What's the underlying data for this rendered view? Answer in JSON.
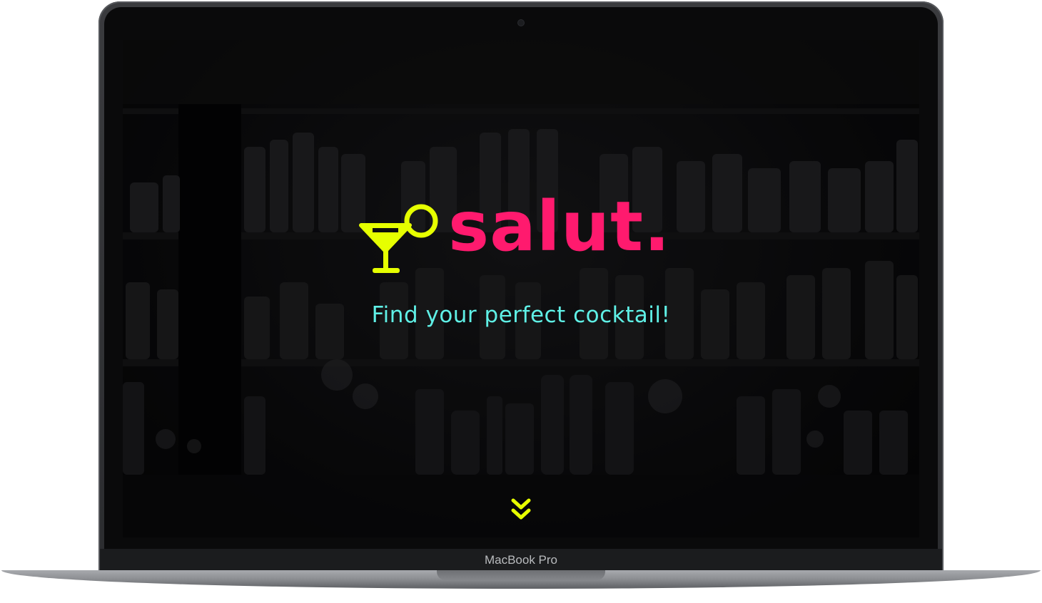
{
  "device": {
    "brand_label": "MacBook Pro"
  },
  "hero": {
    "logo_text": "salut.",
    "logo_icon": "cocktail-glass-icon",
    "tagline": "Find your perfect cocktail!",
    "scroll_icon": "double-chevron-down-icon"
  },
  "colors": {
    "logo_pink": "#ff1a6e",
    "glass_yellow": "#e6ff00",
    "tagline_cyan": "#5ff0e6",
    "background": "#0c0c0e"
  }
}
